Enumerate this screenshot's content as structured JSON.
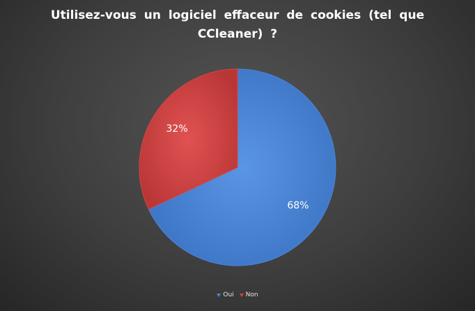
{
  "chart_data": {
    "type": "pie",
    "title": "Utilisez-vous un logiciel effaceur de cookies (tel que CCleaner) ?",
    "categories": [
      "Oui",
      "Non"
    ],
    "values": [
      68,
      32
    ],
    "data_labels": [
      "68%",
      "32%"
    ],
    "colors": [
      "#4a86d9",
      "#d64545"
    ],
    "legend_position": "bottom"
  }
}
